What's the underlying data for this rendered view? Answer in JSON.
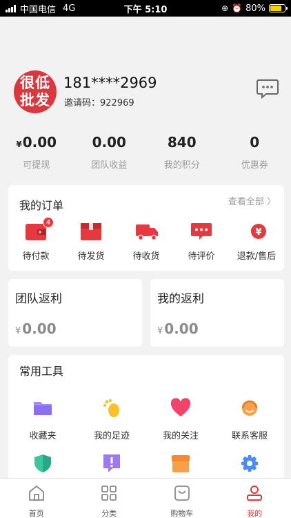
{
  "status_bar": {
    "carrier": "中国电信",
    "network": "4G",
    "time": "下午 5:10",
    "battery": "80%",
    "battery_level": 0.8
  },
  "profile": {
    "avatar_text_line1": "很低",
    "avatar_text_line2": "批发",
    "phone": "181****2969",
    "invite_label": "邀请码：",
    "invite_code": "922969"
  },
  "stats": [
    {
      "currency": "¥",
      "value": "0.00",
      "label": "可提现"
    },
    {
      "currency": "",
      "value": "0.00",
      "label": "团队收益"
    },
    {
      "currency": "",
      "value": "840",
      "label": "我的积分"
    },
    {
      "currency": "",
      "value": "0",
      "label": "优惠券"
    }
  ],
  "orders": {
    "title": "我的订单",
    "view_all": "查看全部 〉",
    "items": [
      {
        "label": "待付款",
        "icon": "wallet-icon",
        "badge": "4"
      },
      {
        "label": "待发货",
        "icon": "package-icon"
      },
      {
        "label": "待收货",
        "icon": "truck-icon"
      },
      {
        "label": "待评价",
        "icon": "comment-icon"
      },
      {
        "label": "退款/售后",
        "icon": "refund-icon"
      }
    ]
  },
  "rebates": {
    "team": {
      "title": "团队返利",
      "currency": "¥",
      "value": "0.00"
    },
    "mine": {
      "title": "我的返利",
      "currency": "¥",
      "value": "0.00"
    }
  },
  "tools": {
    "title": "常用工具",
    "items": [
      {
        "label": "收藏夹",
        "icon": "folder-icon"
      },
      {
        "label": "我的足迹",
        "icon": "footprint-icon"
      },
      {
        "label": "我的关注",
        "icon": "heart-icon"
      },
      {
        "label": "联系客服",
        "icon": "headset-icon"
      },
      {
        "label": "",
        "icon": "shield-icon"
      },
      {
        "label": "",
        "icon": "alert-icon"
      },
      {
        "label": "",
        "icon": "store-icon"
      },
      {
        "label": "",
        "icon": "gear-icon"
      }
    ]
  },
  "tabbar": {
    "items": [
      {
        "label": "首页",
        "icon": "home-icon"
      },
      {
        "label": "分类",
        "icon": "grid-icon"
      },
      {
        "label": "购物车",
        "icon": "cart-icon"
      },
      {
        "label": "我的",
        "icon": "user-icon",
        "active": true
      }
    ]
  },
  "colors": {
    "accent": "#d8393e",
    "background": "#f3f2f2"
  }
}
